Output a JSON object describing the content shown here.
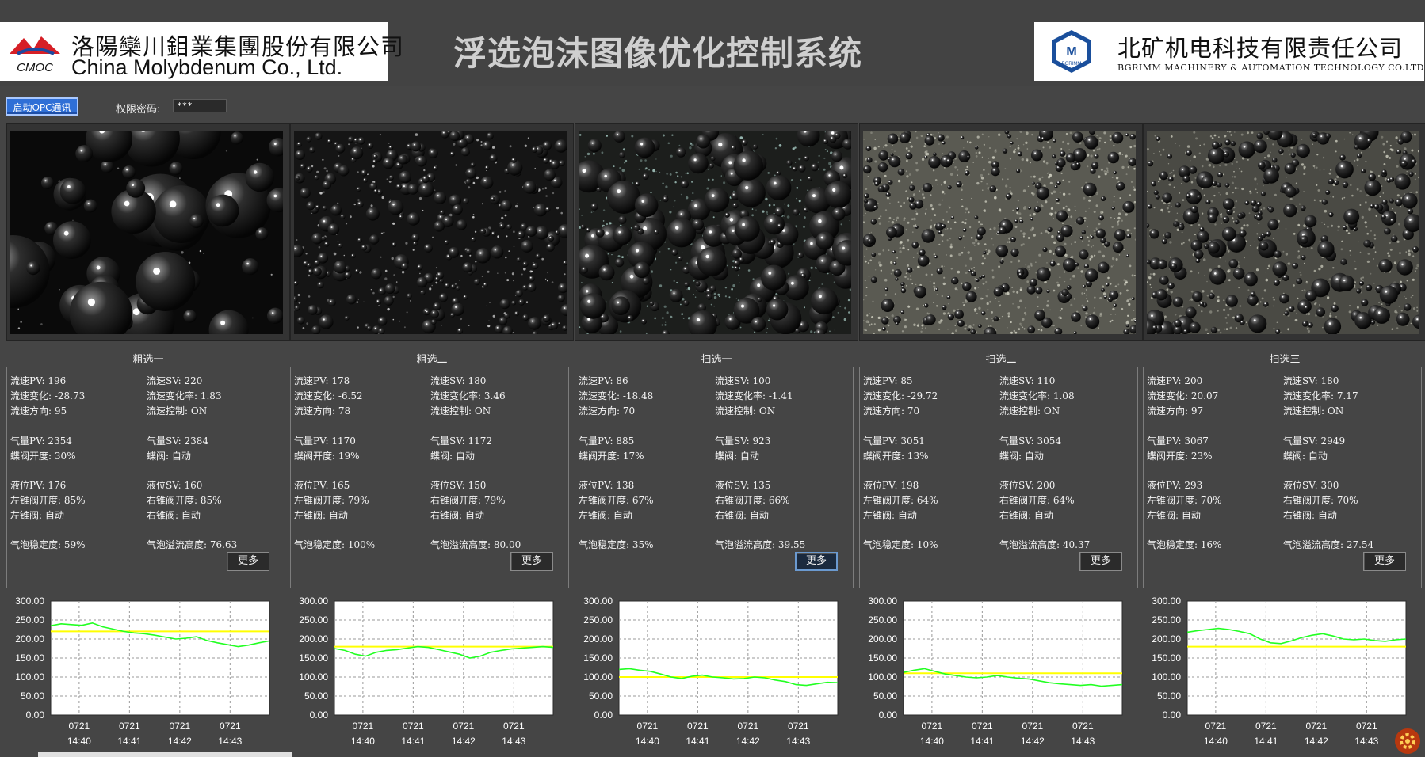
{
  "header": {
    "company_left_cn": "洛陽欒川鉬業集團股份有限公司",
    "company_left_en": "China Molybdenum Co., Ltd.",
    "company_left_abbr": "CMOC",
    "app_title": "浮选泡沫图像优化控制系统",
    "company_right_cn": "北矿机电科技有限责任公司",
    "company_right_en": "BGRIMM MACHINERY & AUTOMATION TECHNOLOGY CO.LTD",
    "company_right_abbr": "BGRIMM"
  },
  "toolbar": {
    "opc_button_label": "启动OPC通讯",
    "password_label": "权限密码:",
    "password_value": "***"
  },
  "colors": {
    "background": "#454545",
    "sv_line": "#ffff00",
    "pv_line": "#22ff22",
    "accent_button": "#2f6fd6"
  },
  "cells": [
    {
      "title": "粗选一",
      "foam_style": "large-bubbles",
      "flow_pv": "流速PV: 196",
      "flow_sv": "流速SV: 220",
      "flow_change": "流速变化: -28.73",
      "flow_change_rate": "流速变化率: 1.83",
      "flow_dir": "流速方向: 95",
      "flow_ctrl": "流速控制: ON",
      "air_pv": "气量PV: 2354",
      "air_sv": "气量SV: 2384",
      "butterfly_open": "蝶阀开度: 30%",
      "butterfly": "蝶阀: 自动",
      "level_pv": "液位PV: 176",
      "level_sv": "液位SV: 160",
      "left_cone_open": "左锥阀开度: 85%",
      "right_cone_open": "右锥阀开度: 85%",
      "left_cone": "左锥阀: 自动",
      "right_cone": "右锥阀: 自动",
      "bubble_stability": "气泡稳定度: 59%",
      "bubble_overflow": "气泡溢流高度: 76.63",
      "more_label": "更多",
      "more_active": false
    },
    {
      "title": "粗选二",
      "foam_style": "small-bubbles",
      "flow_pv": "流速PV: 178",
      "flow_sv": "流速SV: 180",
      "flow_change": "流速变化: -6.52",
      "flow_change_rate": "流速变化率: 3.46",
      "flow_dir": "流速方向: 78",
      "flow_ctrl": "流速控制: ON",
      "air_pv": "气量PV: 1170",
      "air_sv": "气量SV: 1172",
      "butterfly_open": "蝶阀开度: 19%",
      "butterfly": "蝶阀: 自动",
      "level_pv": "液位PV: 165",
      "level_sv": "液位SV: 150",
      "left_cone_open": "左锥阀开度: 79%",
      "right_cone_open": "右锥阀开度: 79%",
      "left_cone": "左锥阀: 自动",
      "right_cone": "右锥阀: 自动",
      "bubble_stability": "气泡稳定度: 100%",
      "bubble_overflow": "气泡溢流高度: 80.00",
      "more_label": "更多",
      "more_active": false
    },
    {
      "title": "扫选一",
      "foam_style": "mixed-bubbles",
      "flow_pv": "流速PV: 86",
      "flow_sv": "流速SV: 100",
      "flow_change": "流速变化: -18.48",
      "flow_change_rate": "流速变化率: -1.41",
      "flow_dir": "流速方向: 70",
      "flow_ctrl": "流速控制: ON",
      "air_pv": "气量PV: 885",
      "air_sv": "气量SV: 923",
      "butterfly_open": "蝶阀开度: 17%",
      "butterfly": "蝶阀: 自动",
      "level_pv": "液位PV: 138",
      "level_sv": "液位SV: 135",
      "left_cone_open": "左锥阀开度: 67%",
      "right_cone_open": "右锥阀开度: 66%",
      "left_cone": "左锥阀: 自动",
      "right_cone": "右锥阀: 自动",
      "bubble_stability": "气泡稳定度: 35%",
      "bubble_overflow": "气泡溢流高度: 39.55",
      "more_label": "更多",
      "more_active": true
    },
    {
      "title": "扫选二",
      "foam_style": "fine-light",
      "flow_pv": "流速PV: 85",
      "flow_sv": "流速SV: 110",
      "flow_change": "流速变化: -29.72",
      "flow_change_rate": "流速变化率: 1.08",
      "flow_dir": "流速方向: 70",
      "flow_ctrl": "流速控制: ON",
      "air_pv": "气量PV: 3051",
      "air_sv": "气量SV: 3054",
      "butterfly_open": "蝶阀开度: 13%",
      "butterfly": "蝶阀: 自动",
      "level_pv": "液位PV: 198",
      "level_sv": "液位SV: 200",
      "left_cone_open": "左锥阀开度: 64%",
      "right_cone_open": "右锥阀开度: 64%",
      "left_cone": "左锥阀: 自动",
      "right_cone": "右锥阀: 自动",
      "bubble_stability": "气泡稳定度: 10%",
      "bubble_overflow": "气泡溢流高度: 40.37",
      "more_label": "更多",
      "more_active": false
    },
    {
      "title": "扫选三",
      "foam_style": "medium-light",
      "flow_pv": "流速PV: 200",
      "flow_sv": "流速SV: 180",
      "flow_change": "流速变化: 20.07",
      "flow_change_rate": "流速变化率: 7.17",
      "flow_dir": "流速方向: 97",
      "flow_ctrl": "流速控制: ON",
      "air_pv": "气量PV: 3067",
      "air_sv": "气量SV: 2949",
      "butterfly_open": "蝶阀开度: 23%",
      "butterfly": "蝶阀: 自动",
      "level_pv": "液位PV: 293",
      "level_sv": "液位SV: 300",
      "left_cone_open": "左锥阀开度: 70%",
      "right_cone_open": "右锥阀开度: 70%",
      "left_cone": "左锥阀: 自动",
      "right_cone": "右锥阀: 自动",
      "bubble_stability": "气泡稳定度: 16%",
      "bubble_overflow": "气泡溢流高度: 27.54",
      "more_label": "更多",
      "more_active": false
    }
  ],
  "chart_data": [
    {
      "type": "line",
      "ylim": [
        0,
        300
      ],
      "yticks": [
        "300.00",
        "250.00",
        "200.00",
        "150.00",
        "100.00",
        "50.00",
        "0.00"
      ],
      "xticks": [
        [
          "0721",
          "14:40"
        ],
        [
          "0721",
          "14:41"
        ],
        [
          "0721",
          "14:42"
        ],
        [
          "0721",
          "14:43"
        ]
      ],
      "setpoint": 220,
      "series": [
        {
          "values": [
            235,
            240,
            238,
            236,
            242,
            232,
            226,
            220,
            216,
            214,
            210,
            205,
            200,
            202,
            206,
            196,
            190,
            185,
            180,
            184,
            190,
            195
          ]
        }
      ]
    },
    {
      "type": "line",
      "ylim": [
        0,
        300
      ],
      "yticks": [
        "300.00",
        "250.00",
        "200.00",
        "150.00",
        "100.00",
        "50.00",
        "0.00"
      ],
      "xticks": [
        [
          "0721",
          "14:40"
        ],
        [
          "0721",
          "14:41"
        ],
        [
          "0721",
          "14:42"
        ],
        [
          "0721",
          "14:43"
        ]
      ],
      "setpoint": 180,
      "series": [
        {
          "values": [
            175,
            170,
            160,
            155,
            165,
            170,
            172,
            176,
            180,
            178,
            172,
            166,
            160,
            150,
            155,
            165,
            170,
            174,
            176,
            178,
            180,
            178
          ]
        }
      ]
    },
    {
      "type": "line",
      "ylim": [
        0,
        300
      ],
      "yticks": [
        "300.00",
        "250.00",
        "200.00",
        "150.00",
        "100.00",
        "50.00",
        "0.00"
      ],
      "xticks": [
        [
          "0721",
          "14:40"
        ],
        [
          "0721",
          "14:41"
        ],
        [
          "0721",
          "14:42"
        ],
        [
          "0721",
          "14:43"
        ]
      ],
      "setpoint": 100,
      "series": [
        {
          "values": [
            120,
            122,
            118,
            115,
            108,
            100,
            96,
            102,
            105,
            100,
            98,
            95,
            96,
            100,
            98,
            92,
            88,
            80,
            78,
            82,
            86,
            85
          ]
        }
      ]
    },
    {
      "type": "line",
      "ylim": [
        0,
        300
      ],
      "yticks": [
        "300.00",
        "250.00",
        "200.00",
        "150.00",
        "100.00",
        "50.00",
        "0.00"
      ],
      "xticks": [
        [
          "0721",
          "14:40"
        ],
        [
          "0721",
          "14:41"
        ],
        [
          "0721",
          "14:42"
        ],
        [
          "0721",
          "14:43"
        ]
      ],
      "setpoint": 110,
      "series": [
        {
          "values": [
            112,
            118,
            122,
            115,
            108,
            104,
            100,
            98,
            100,
            104,
            100,
            97,
            95,
            90,
            85,
            82,
            80,
            78,
            80,
            76,
            78,
            80
          ]
        }
      ]
    },
    {
      "type": "line",
      "ylim": [
        0,
        300
      ],
      "yticks": [
        "300.00",
        "250.00",
        "200.00",
        "150.00",
        "100.00",
        "50.00",
        "0.00"
      ],
      "xticks": [
        [
          "0721",
          "14:40"
        ],
        [
          "0721",
          "14:41"
        ],
        [
          "0721",
          "14:42"
        ],
        [
          "0721",
          "14:43"
        ]
      ],
      "setpoint": 180,
      "series": [
        {
          "values": [
            218,
            222,
            225,
            228,
            225,
            220,
            214,
            200,
            190,
            188,
            195,
            204,
            210,
            214,
            208,
            200,
            198,
            200,
            196,
            194,
            198,
            200
          ]
        }
      ]
    }
  ]
}
